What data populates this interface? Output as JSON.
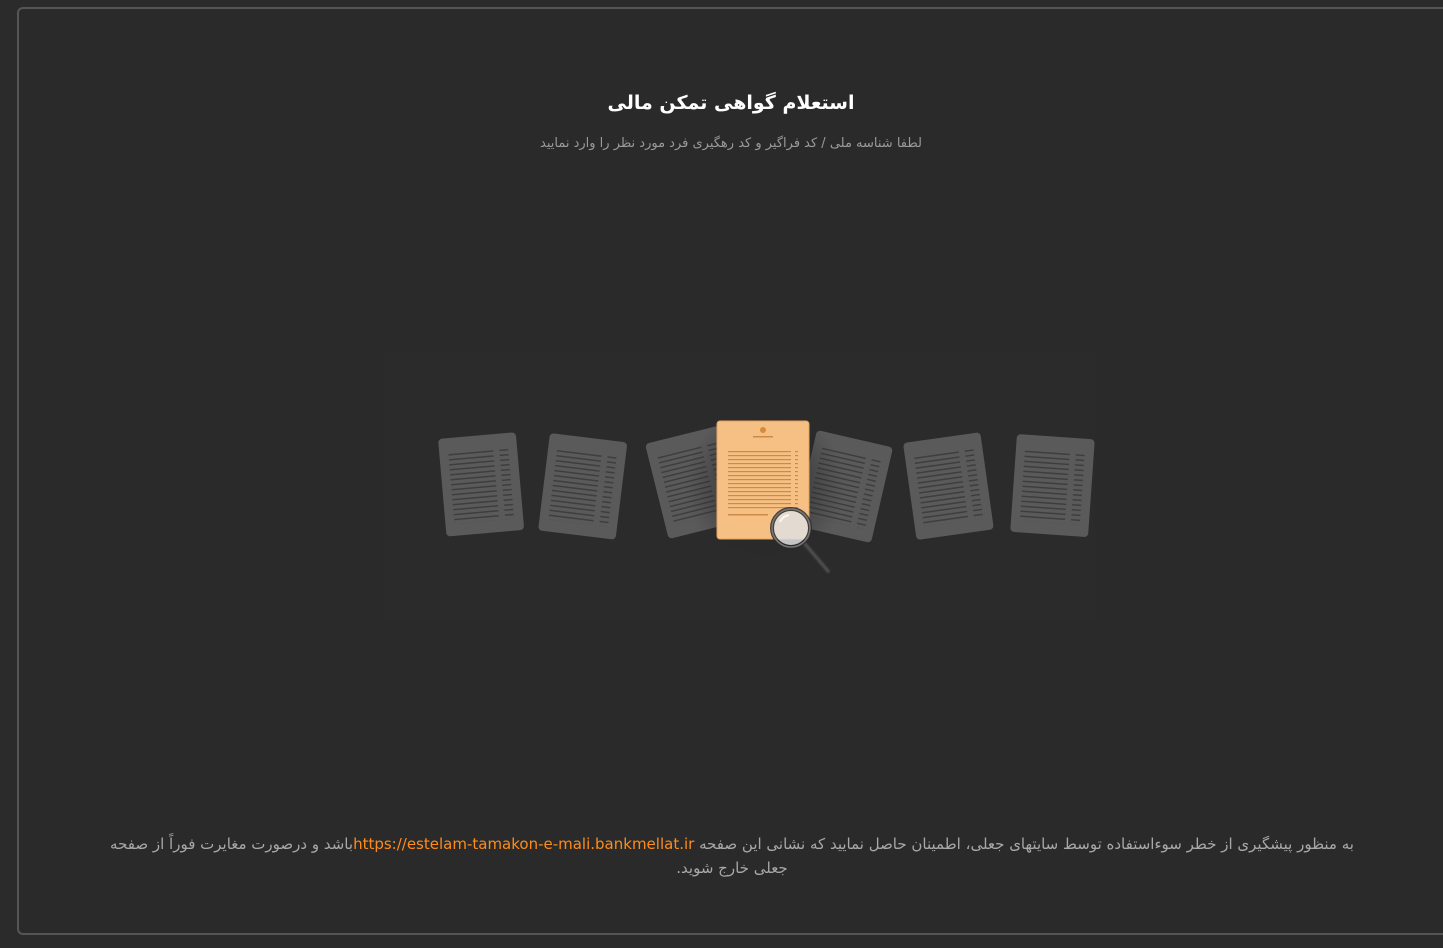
{
  "page": {
    "title": "استعلام گواهی تمکن مالی",
    "subtitle": "لطفا شناسه ملی / کد فراگیر و کد رهگیری فرد مورد نظر را وارد نمایید"
  },
  "illustration": {
    "icon": "document-search-illustration",
    "accent_color": "#f6c084",
    "paper_color": "#5c5c5c"
  },
  "notice": {
    "text_before": "به منظور پیشگیری از خطر سوءاستفاده توسط سایتهای جعلی، اطمینان حاصل نمایید که نشانی این صفحه ",
    "link": "https://estelam-tamakon-e-mali.bankmellat.ir",
    "text_after": "باشد و درصورت مغایرت فوراً از صفحه جعلی خارج شوید."
  },
  "colors": {
    "background": "#2a2a2a",
    "border": "#555555",
    "link": "#ff8c1a",
    "title": "#ffffff",
    "muted_text": "#9a9a9a"
  }
}
